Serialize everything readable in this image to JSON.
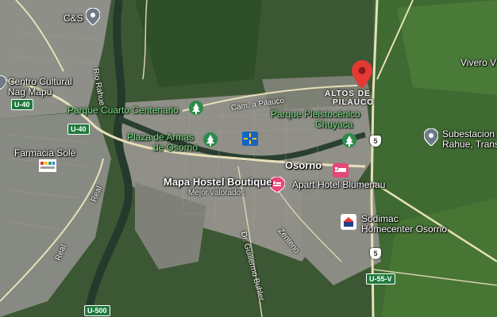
{
  "map": {
    "places": {
      "cs": "C&S",
      "centro_cultural_1": "Centro Cultural",
      "centro_cultural_2": "Nag Mapu",
      "farmacia": "Farmacia Solé",
      "altos_1": "ALTOS DE",
      "altos_2": "PILAUCO",
      "vivero": "Vivero V",
      "subestacion_1": "Subestacion",
      "subestacion_2": "Rahue, Trans",
      "parque_cuarto": "Parque Cuarto Centenario",
      "parque_pleisto_1": "Parque Pleistocénico",
      "parque_pleisto_2": "Chuyaca",
      "plaza_1": "Plaza de Armas",
      "plaza_2": "de Osorno",
      "osorno": "Osorno",
      "mapa_hostel": "Mapa Hostel Boutique",
      "mejor_valorados": "Mejor valorados",
      "apart_hotel": "Apart Hotel Blumenau",
      "sodimac_1": "Sodimac",
      "sodimac_2": "Homecenter Osorno"
    },
    "roads": {
      "rio_rahue": "Rio Rahue",
      "cam_pilauco": "Cam. a Pilauco",
      "real_1": "Real",
      "real_2": "Real",
      "zenteno": "Zenteno",
      "guillermo": "Dr. Guillermo Buhler"
    },
    "route_shields": {
      "u40_a": "U-40",
      "u40_b": "U-40",
      "u55v": "U-55-V",
      "u500": "U-500",
      "r5_a": "5",
      "r5_b": "5"
    },
    "icons": [
      "map-pin-red",
      "park-tree",
      "walmart-store",
      "hotel-bed",
      "pharmacy-logo",
      "place-pin-gray",
      "sodimac-logo"
    ],
    "colors": {
      "park_label": "#7ee08a",
      "pin_red": "#e53935",
      "hotel_pink": "#e8457a",
      "shield_green": "#1f7a3c"
    }
  }
}
